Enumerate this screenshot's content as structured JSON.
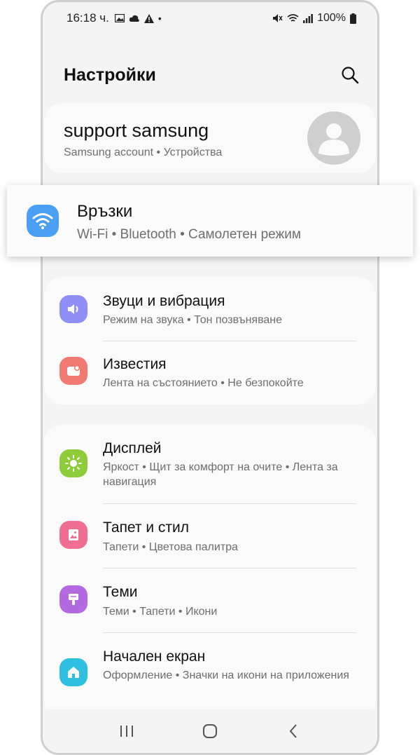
{
  "status_bar": {
    "time": "16:18 ч.",
    "battery": "100%"
  },
  "header": {
    "title": "Настройки"
  },
  "account": {
    "name": "support samsung",
    "subtitle": "Samsung account  •  Устройства"
  },
  "connections": {
    "title": "Връзки",
    "subtitle": "Wi-Fi  •  Bluetooth  •  Самолетен режим",
    "icon_color": "#4a9ff5"
  },
  "group1": [
    {
      "title": "Звуци и вибрация",
      "subtitle": "Режим на звука  •  Тон позвъняване",
      "icon": "speaker-icon",
      "color": "#8f8ff5"
    },
    {
      "title": "Известия",
      "subtitle": "Лента на състоянието  •  Не безпокойте",
      "icon": "notification-icon",
      "color": "#f17b72"
    }
  ],
  "group2": [
    {
      "title": "Дисплей",
      "subtitle": "Яркост  •  Щит за комфорт на очите  •  Лента за навигация",
      "icon": "brightness-icon",
      "color": "#8ecc3a"
    },
    {
      "title": "Тапет и стил",
      "subtitle": "Тапети  •  Цветова палитра",
      "icon": "wallpaper-icon",
      "color": "#ef6e92"
    },
    {
      "title": "Теми",
      "subtitle": "Теми  •  Тапети  •  Икони",
      "icon": "theme-brush-icon",
      "color": "#b36ae0"
    },
    {
      "title": "Начален екран",
      "subtitle": "Оформление  •  Значки на икони на приложения",
      "icon": "home-icon",
      "color": "#2fbfe0"
    }
  ]
}
